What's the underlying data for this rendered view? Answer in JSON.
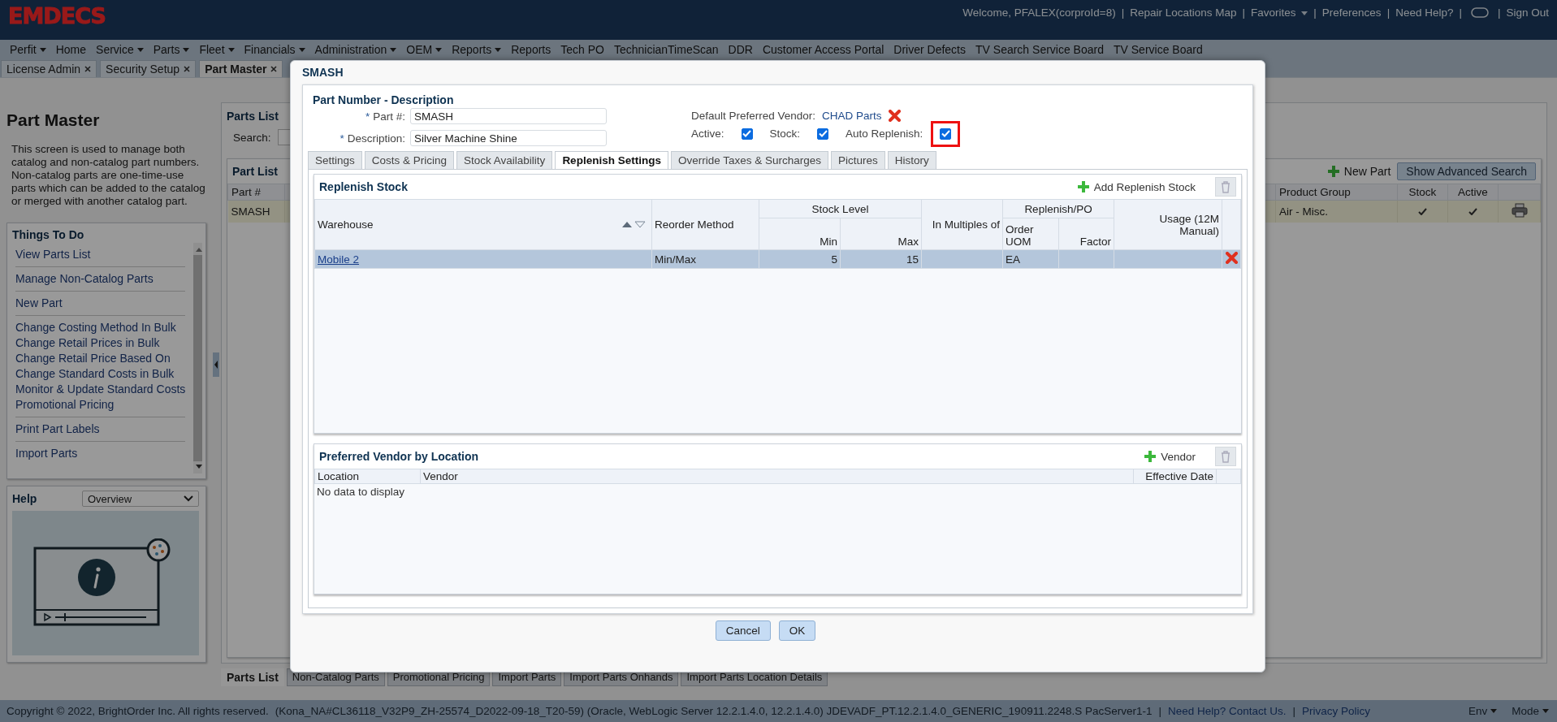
{
  "header": {
    "logo": "EMDECS",
    "links": [
      {
        "kind": "text",
        "label": "Welcome, PFALEX(corproId=8)"
      },
      {
        "kind": "separator",
        "label": "|"
      },
      {
        "kind": "link",
        "label": "Repair Locations Map"
      },
      {
        "kind": "separator",
        "label": "|"
      },
      {
        "kind": "menu",
        "label": "Favorites"
      },
      {
        "kind": "separator",
        "label": "|"
      },
      {
        "kind": "link",
        "label": "Preferences"
      },
      {
        "kind": "separator",
        "label": "|"
      },
      {
        "kind": "link",
        "label": "Need Help?"
      },
      {
        "kind": "separator",
        "label": "|"
      },
      {
        "kind": "icon"
      },
      {
        "kind": "separator",
        "label": "|"
      },
      {
        "kind": "link",
        "label": "Sign Out"
      }
    ]
  },
  "menu": [
    {
      "label": "Perfit",
      "dropdown": true
    },
    {
      "label": "Home",
      "dropdown": false
    },
    {
      "label": "Service",
      "dropdown": true
    },
    {
      "label": "Parts",
      "dropdown": true
    },
    {
      "label": "Fleet",
      "dropdown": true
    },
    {
      "label": "Financials",
      "dropdown": true
    },
    {
      "label": "Administration",
      "dropdown": true
    },
    {
      "label": "OEM",
      "dropdown": true
    },
    {
      "label": "Reports",
      "dropdown": true
    },
    {
      "label": "Reports",
      "dropdown": false
    },
    {
      "label": "Tech PO",
      "dropdown": false
    },
    {
      "label": "TechnicianTimeScan",
      "dropdown": false
    },
    {
      "label": "DDR",
      "dropdown": false
    },
    {
      "label": "Customer Access Portal",
      "dropdown": false
    },
    {
      "label": "Driver Defects",
      "dropdown": false
    },
    {
      "label": "TV Search Service Board",
      "dropdown": false
    },
    {
      "label": "TV Service Board",
      "dropdown": false
    }
  ],
  "page_tabs": [
    {
      "label": "License Admin",
      "selected": false
    },
    {
      "label": "Security Setup",
      "selected": false
    },
    {
      "label": "Part Master",
      "selected": true
    }
  ],
  "sidebar": {
    "title": "Part Master",
    "description": "This screen is used to manage both catalog and non-catalog part numbers. Non-catalog parts are one-time-use parts which can be added to the catalog or merged with another catalog part.",
    "things_to_do": {
      "title": "Things To Do",
      "groups": [
        [
          "View Parts List"
        ],
        [
          "Manage Non-Catalog Parts"
        ],
        [
          "New Part"
        ],
        [
          "Change Costing Method In Bulk",
          "Change Retail Prices in Bulk",
          "Change Retail Price Based On",
          "Change Standard Costs in Bulk",
          "Monitor & Update Standard Costs",
          "Promotional Pricing"
        ],
        [
          "Print Part Labels"
        ],
        [
          "Import Parts"
        ]
      ]
    },
    "help": {
      "title": "Help",
      "topic": "Overview"
    }
  },
  "parts_list": {
    "title": "Parts List",
    "search_label": "Search:",
    "part_list": {
      "title": "Part List",
      "new_part": "New Part",
      "advanced_search": "Show Advanced Search",
      "columns": [
        "Part #",
        "Product Group",
        "Stock",
        "Active"
      ],
      "rows": [
        {
          "part": "SMASH",
          "product_group": "Air - Misc.",
          "stock": true,
          "active": true
        }
      ]
    }
  },
  "bottom_tabs": [
    {
      "label": "Parts List",
      "selected": true
    },
    {
      "label": "Non-Catalog Parts",
      "selected": false
    },
    {
      "label": "Promotional Pricing",
      "selected": false
    },
    {
      "label": "Import Parts",
      "selected": false
    },
    {
      "label": "Import Parts Onhands",
      "selected": false
    },
    {
      "label": "Import Parts Location Details",
      "selected": false
    }
  ],
  "dialog": {
    "title": "SMASH",
    "section_title": "Part Number - Description",
    "fields": [
      {
        "marker": "*",
        "label": "Part #:",
        "value": "SMASH"
      },
      {
        "marker": "*",
        "label": "Description:",
        "value": "Silver Machine Shine"
      }
    ],
    "vendor_label": "Default Preferred Vendor:",
    "vendor": "CHAD Parts",
    "checkboxes": [
      {
        "label": "Active:",
        "checked": true,
        "highlighted": false
      },
      {
        "label": "Stock:",
        "checked": true,
        "highlighted": false
      },
      {
        "label": "Auto Replenish:",
        "checked": true,
        "highlighted": true
      }
    ],
    "tabs": [
      {
        "label": "Settings",
        "selected": false
      },
      {
        "label": "Costs & Pricing",
        "selected": false
      },
      {
        "label": "Stock Availability",
        "selected": false
      },
      {
        "label": "Replenish Settings",
        "selected": true
      },
      {
        "label": "Override Taxes & Surcharges",
        "selected": false
      },
      {
        "label": "Pictures",
        "selected": false
      },
      {
        "label": "History",
        "selected": false
      }
    ],
    "replenish": {
      "title": "Replenish Stock",
      "add_label": "Add Replenish Stock",
      "columns": [
        {
          "label": "Warehouse",
          "kind": "text",
          "sortable": true
        },
        {
          "label": "Reorder Method",
          "kind": "text",
          "sortable": false
        },
        {
          "label": "Stock Level",
          "colspan": 2,
          "children": [
            {
              "label": "Min",
              "kind": "number",
              "sortable": false
            },
            {
              "label": "Max",
              "kind": "number",
              "sortable": false
            }
          ]
        },
        {
          "label": "In Multiples of",
          "kind": "number",
          "sortable": false
        },
        {
          "label": "Replenish/PO",
          "colspan": 2,
          "children": [
            {
              "label": "Order UOM",
              "kind": "text",
              "sortable": false
            },
            {
              "label": "Factor",
              "kind": "number",
              "sortable": false
            }
          ]
        },
        {
          "label": "Usage (12M Manual)",
          "kind": "number",
          "sortable": false
        }
      ],
      "rows": [
        {
          "selected": true,
          "cells": [
            "Mobile 2",
            "Min/Max",
            "5",
            "15",
            null,
            "EA",
            null,
            null
          ]
        }
      ]
    },
    "vendors": {
      "title": "Preferred Vendor by Location",
      "add_label": "Vendor",
      "columns": [
        "Location",
        "Vendor",
        "Effective Date"
      ],
      "empty_text": "No data to display"
    },
    "buttons": [
      "Cancel",
      "OK"
    ]
  },
  "footer": {
    "copyright": "Copyright © 2022, BrightOrder Inc. All rights reserved.",
    "build": "(Kona_NA#CL36118_V32P9_ZH-25574_D2022-09-18_T20-59) (Oracle, WebLogic Server 12.2.1.4.0, 12.2.1.4.0) JDEVADF_PT.12.2.1.4.0_GENERIC_190911.2248.S PacServer1-1",
    "links": [
      {
        "kind": "separator",
        "label": "|"
      },
      {
        "kind": "link",
        "label": "Need Help? Contact Us."
      },
      {
        "kind": "separator",
        "label": "|"
      },
      {
        "kind": "link",
        "label": "Privacy Policy"
      }
    ],
    "menus": [
      "Env",
      "Mode"
    ]
  }
}
